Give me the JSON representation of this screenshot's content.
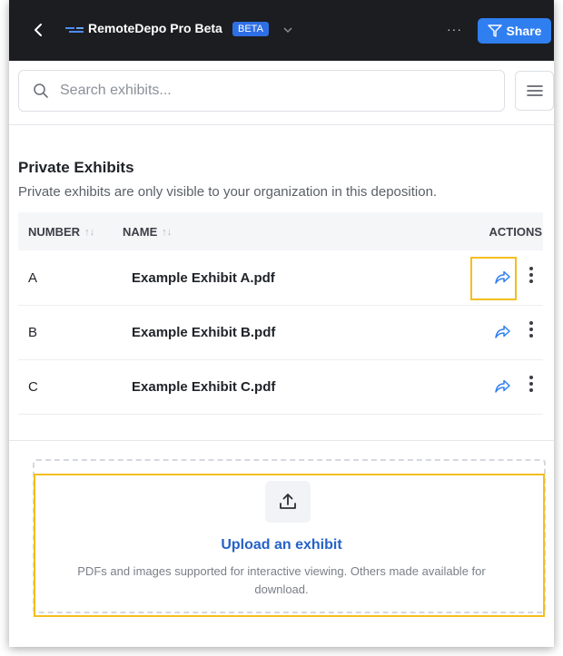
{
  "topbar": {
    "app_title": "RemoteDepo Pro Beta",
    "badge": "BETA",
    "more": "···",
    "share_label": "Share"
  },
  "search": {
    "placeholder": "Search exhibits..."
  },
  "section": {
    "title": "Private Exhibits",
    "description": "Private exhibits are only visible to your organization in this deposition."
  },
  "table": {
    "columns": {
      "number": "NUMBER",
      "name": "NAME",
      "actions": "ACTIONS"
    },
    "rows": [
      {
        "number": "A",
        "name": "Example Exhibit A.pdf"
      },
      {
        "number": "B",
        "name": "Example Exhibit B.pdf"
      },
      {
        "number": "C",
        "name": "Example Exhibit C.pdf"
      }
    ]
  },
  "upload": {
    "title": "Upload an exhibit",
    "description": "PDFs and images supported for interactive viewing. Others made available for download."
  },
  "colors": {
    "topbar_bg": "#1c1d20",
    "accent": "#2f7ff0",
    "highlight": "#f3be1f",
    "link": "#2563c7"
  },
  "icons": [
    "chevron-left-icon",
    "app-logo-icon",
    "chevron-down-icon",
    "share-icon",
    "search-icon",
    "hamburger-menu-icon",
    "sort-icon",
    "forward-arrow-icon",
    "kebab-menu-icon",
    "upload-icon"
  ]
}
